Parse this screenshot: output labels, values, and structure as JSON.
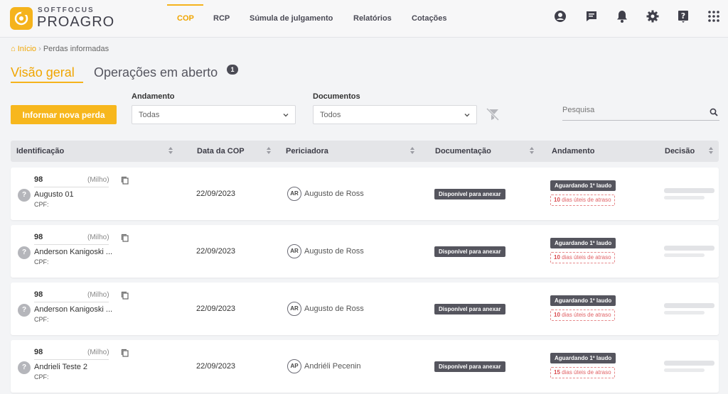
{
  "header": {
    "brand_small": "SOFTFOCUS",
    "brand_big": "PROAGRO",
    "nav": [
      {
        "label": "COP",
        "active": true
      },
      {
        "label": "RCP"
      },
      {
        "label": "Súmula de julgamento"
      },
      {
        "label": "Relatórios"
      },
      {
        "label": "Cotações"
      }
    ],
    "icons": [
      "account-icon",
      "chat-icon",
      "bell-icon",
      "gear-icon",
      "help-icon",
      "apps-grid-icon"
    ]
  },
  "breadcrumb": {
    "home": "Início",
    "separator": "›",
    "current": "Perdas informadas"
  },
  "tabs": {
    "overview": "Visão geral",
    "open_ops": "Operações em aberto",
    "open_ops_count": "1"
  },
  "toolbar": {
    "new_loss_button": "Informar nova perda",
    "andamento_label": "Andamento",
    "andamento_value": "Todas",
    "documentos_label": "Documentos",
    "documentos_value": "Todos",
    "search_placeholder": "Pesquisa"
  },
  "table": {
    "columns": [
      "Identificação",
      "Data da COP",
      "Periciadora",
      "Documentação",
      "Andamento",
      "Decisão"
    ],
    "rows": [
      {
        "id_prefix": "98",
        "crop": "(Milho)",
        "name": "Augusto 01",
        "cpf": "CPF:",
        "date": "22/09/2023",
        "perito_initials": "AR",
        "perito": "Augusto de Ross",
        "doc": "Disponível para anexar",
        "status": "Aguardando 1º laudo",
        "delay_days": "10",
        "delay_text": "dias úteis de atraso"
      },
      {
        "id_prefix": "98",
        "crop": "(Milho)",
        "name": "Anderson Kanigoski ...",
        "cpf": "CPF:",
        "date": "22/09/2023",
        "perito_initials": "AR",
        "perito": "Augusto de Ross",
        "doc": "Disponível para anexar",
        "status": "Aguardando 1º laudo",
        "delay_days": "10",
        "delay_text": "dias úteis de atraso"
      },
      {
        "id_prefix": "98",
        "crop": "(Milho)",
        "name": "Anderson Kanigoski ...",
        "cpf": "CPF:",
        "date": "22/09/2023",
        "perito_initials": "AR",
        "perito": "Augusto de Ross",
        "doc": "Disponível para anexar",
        "status": "Aguardando 1º laudo",
        "delay_days": "10",
        "delay_text": "dias úteis de atraso"
      },
      {
        "id_prefix": "98",
        "crop": "(Milho)",
        "name": "Andrieli Teste 2",
        "cpf": "CPF:",
        "date": "22/09/2023",
        "perito_initials": "AP",
        "perito": "Andriéli Pecenin",
        "doc": "Disponível para anexar",
        "status": "Aguardando 1º laudo",
        "delay_days": "15",
        "delay_text": "dias úteis de atraso"
      }
    ]
  },
  "colors": {
    "accent": "#f5b31c",
    "badge_dark": "#55555e",
    "delay_red": "#e06064"
  }
}
